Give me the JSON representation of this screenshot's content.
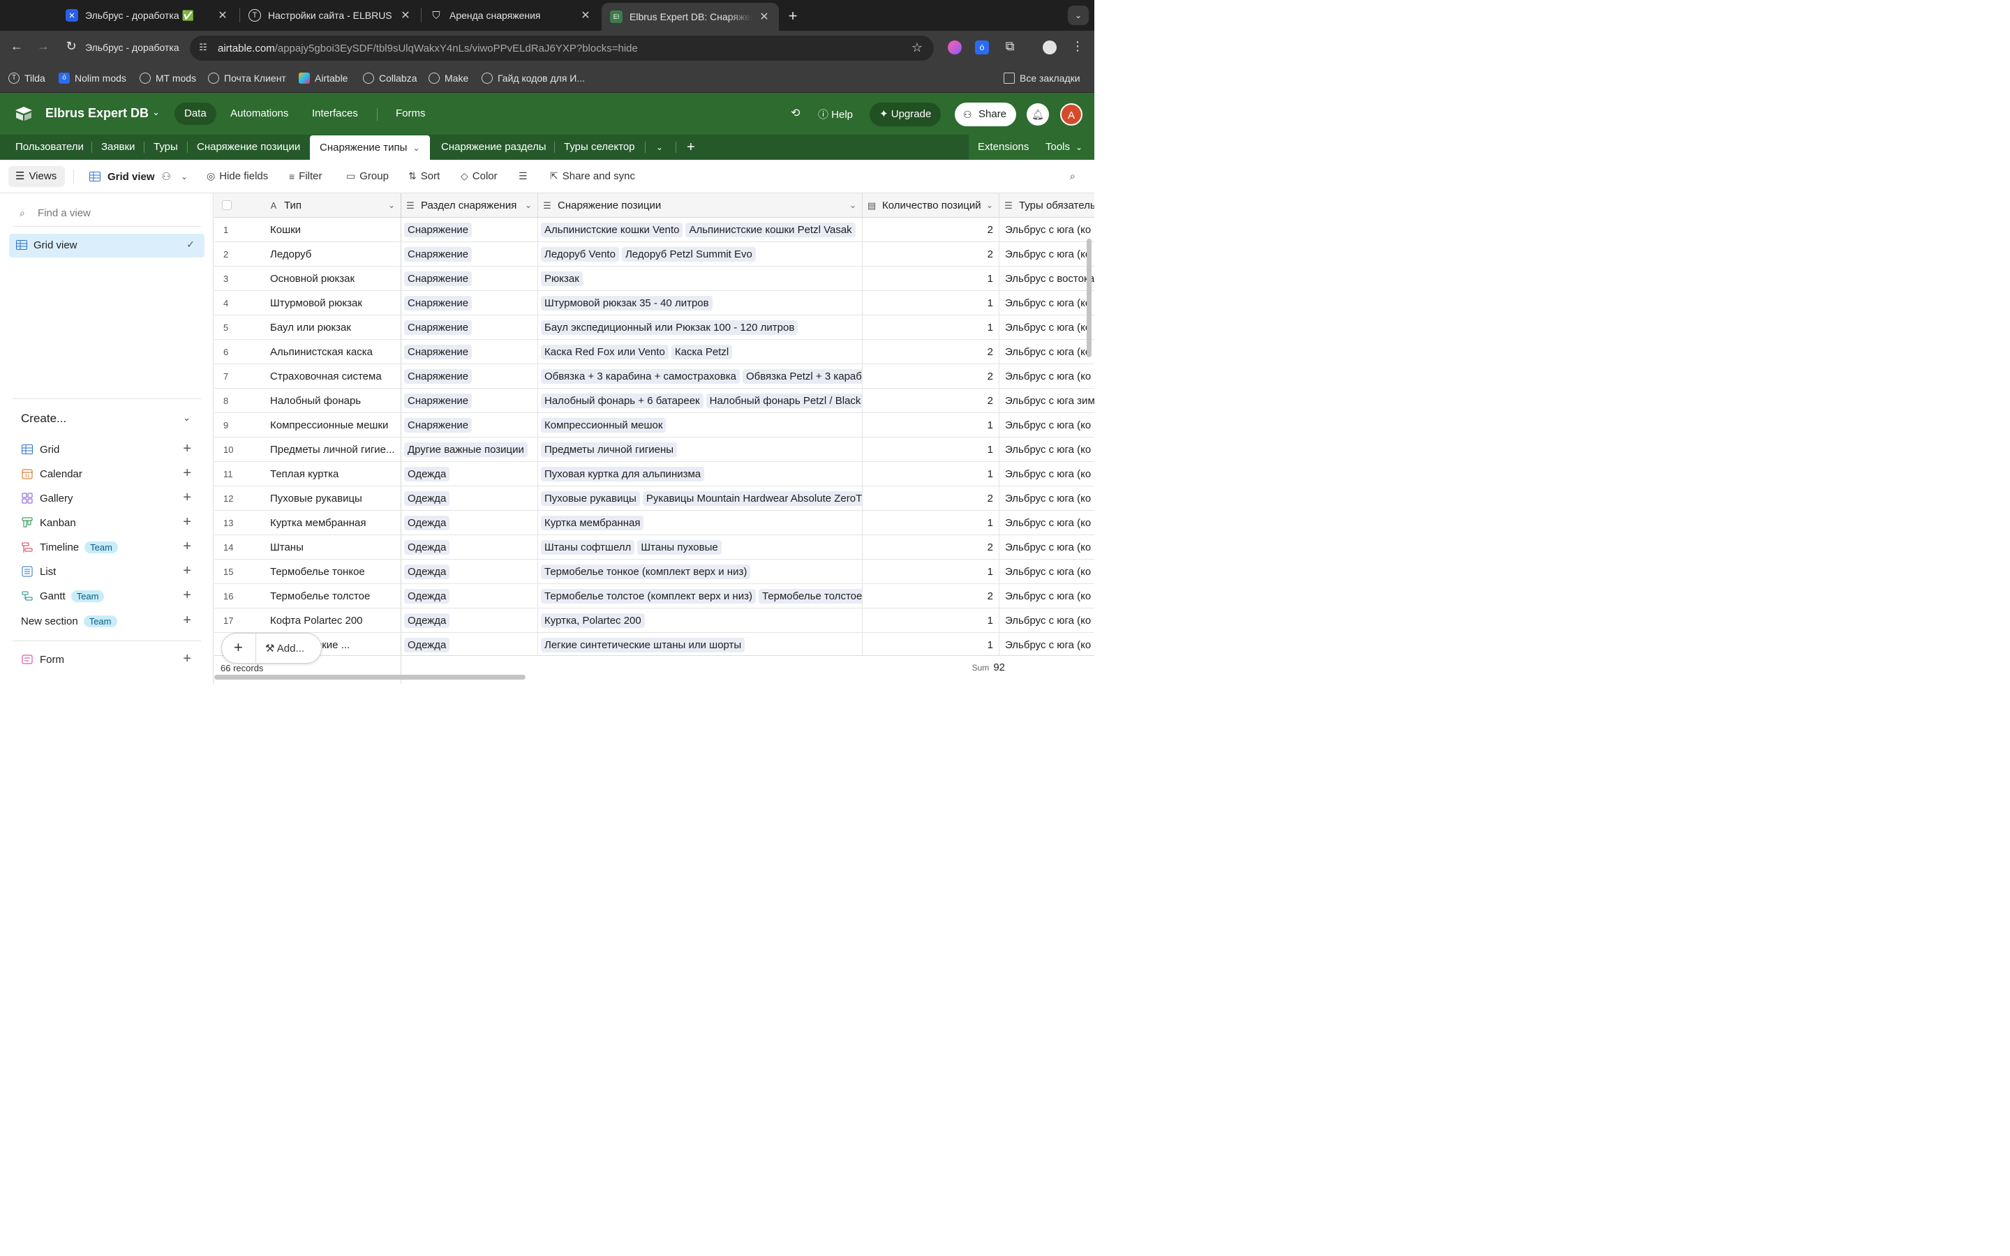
{
  "browser": {
    "tabs": [
      {
        "title": "Эльбрус - доработка ✅"
      },
      {
        "title": "Настройки сайта - ELBRUS E"
      },
      {
        "title": "Аренда снаряжения"
      },
      {
        "title": "Elbrus Expert DB: Снаряжени"
      }
    ],
    "profile_label": "Эльбрус - доработка",
    "url_host": "airtable.com",
    "url_path": "/appajy5gboi3EySDF/tbl9sUlqWakxY4nLs/viwoPPvELdRaJ6YXP?blocks=hide",
    "bookmarks": [
      "Tilda",
      "Nolim mods",
      "MT mods",
      "Почта Клиент",
      "Airtable",
      "Collabza",
      "Make",
      "Гайд кодов для И..."
    ],
    "all_bookmarks": "Все закладки"
  },
  "app": {
    "base_name": "Elbrus Expert DB",
    "nav": [
      "Data",
      "Automations",
      "Interfaces",
      "Forms"
    ],
    "help": "Help",
    "upgrade": "Upgrade",
    "share": "Share",
    "avatar_letter": "A",
    "brand_color": "#2d6b2f"
  },
  "tables": {
    "items": [
      "Пользователи",
      "Заявки",
      "Туры",
      "Снаряжение позиции",
      "Снаряжение типы",
      "Снаряжение разделы",
      "Туры селектор"
    ],
    "active": "Снаряжение типы",
    "extensions": "Extensions",
    "tools": "Tools"
  },
  "viewbar": {
    "views": "Views",
    "view_name": "Grid view",
    "hide_fields": "Hide fields",
    "filter": "Filter",
    "group": "Group",
    "sort": "Sort",
    "color": "Color",
    "share_sync": "Share and sync"
  },
  "sidebar": {
    "find_placeholder": "Find a view",
    "current_view": "Grid view",
    "create_label": "Create...",
    "create_items": [
      {
        "label": "Grid",
        "team": ""
      },
      {
        "label": "Calendar",
        "team": ""
      },
      {
        "label": "Gallery",
        "team": ""
      },
      {
        "label": "Kanban",
        "team": ""
      },
      {
        "label": "Timeline",
        "team": "Team"
      },
      {
        "label": "List",
        "team": ""
      },
      {
        "label": "Gantt",
        "team": "Team"
      },
      {
        "label": "New section",
        "team": "Team"
      }
    ],
    "form_label": "Form"
  },
  "grid": {
    "columns": [
      "Тип",
      "Раздел снаряжения",
      "Снаряжение позиции",
      "Количество позиций",
      "Туры обязатель"
    ],
    "rows": [
      {
        "n": "1",
        "type": "Кошки",
        "section": "Снаряжение",
        "items": [
          "Альпинистские кошки Vento",
          "Альпинистские кошки Petzl Vasak"
        ],
        "count": "2",
        "tour": "Эльбрус с юга (ко"
      },
      {
        "n": "2",
        "type": "Ледоруб",
        "section": "Снаряжение",
        "items": [
          "Ледоруб Vento",
          "Ледоруб Petzl Summit Evo"
        ],
        "count": "2",
        "tour": "Эльбрус с юга (ко"
      },
      {
        "n": "3",
        "type": "Основной рюкзак",
        "section": "Снаряжение",
        "items": [
          "Рюкзак"
        ],
        "count": "1",
        "tour": "Эльбрус с востока"
      },
      {
        "n": "4",
        "type": "Штурмовой рюкзак",
        "section": "Снаряжение",
        "items": [
          "Штурмовой рюкзак 35 - 40 литров"
        ],
        "count": "1",
        "tour": "Эльбрус с юга (ко"
      },
      {
        "n": "5",
        "type": "Баул или рюкзак",
        "section": "Снаряжение",
        "items": [
          "Баул экспедиционный или Рюкзак 100 - 120 литров"
        ],
        "count": "1",
        "tour": "Эльбрус с юга (ко"
      },
      {
        "n": "6",
        "type": "Альпинистская каска",
        "section": "Снаряжение",
        "items": [
          "Каска Red Fox или Vento",
          "Каска Petzl"
        ],
        "count": "2",
        "tour": "Эльбрус с юга (ко"
      },
      {
        "n": "7",
        "type": "Страховочная система",
        "section": "Снаряжение",
        "items": [
          "Обвязка + 3 карабина + самостраховка",
          "Обвязка Petzl + 3 караби"
        ],
        "count": "2",
        "tour": "Эльбрус с юга (ко"
      },
      {
        "n": "8",
        "type": "Налобный фонарь",
        "section": "Снаряжение",
        "items": [
          "Налобный фонарь + 6 батареек",
          "Налобный фонарь Petzl / Black D"
        ],
        "count": "2",
        "tour": "Эльбрус с юга зим"
      },
      {
        "n": "9",
        "type": "Компрессионные мешки",
        "section": "Снаряжение",
        "items": [
          "Компрессионный мешок"
        ],
        "count": "1",
        "tour": "Эльбрус с юга (ко"
      },
      {
        "n": "10",
        "type": "Предметы личной гигие...",
        "section": "Другие важные позиции",
        "items": [
          "Предметы личной гигиены"
        ],
        "count": "1",
        "tour": "Эльбрус с юга (ко"
      },
      {
        "n": "11",
        "type": "Теплая куртка",
        "section": "Одежда",
        "items": [
          "Пуховая куртка для альпинизма"
        ],
        "count": "1",
        "tour": "Эльбрус с юга (ко"
      },
      {
        "n": "12",
        "type": "Пуховые рукавицы",
        "section": "Одежда",
        "items": [
          "Пуховые рукавицы",
          "Рукавицы Mountain Hardwear Absolute ZeroTM"
        ],
        "count": "2",
        "tour": "Эльбрус с юга (ко"
      },
      {
        "n": "13",
        "type": "Куртка мембранная",
        "section": "Одежда",
        "items": [
          "Куртка мембранная"
        ],
        "count": "1",
        "tour": "Эльбрус с юга (ко"
      },
      {
        "n": "14",
        "type": "Штаны",
        "section": "Одежда",
        "items": [
          "Штаны софтшелл",
          "Штаны пуховые"
        ],
        "count": "2",
        "tour": "Эльбрус с юга (ко"
      },
      {
        "n": "15",
        "type": "Термобелье тонкое",
        "section": "Одежда",
        "items": [
          "Термобелье тонкое (комплект верх и низ)"
        ],
        "count": "1",
        "tour": "Эльбрус с юга (ко"
      },
      {
        "n": "16",
        "type": "Термобелье толстое",
        "section": "Одежда",
        "items": [
          "Термобелье толстое (комплект верх и низ)",
          "Термобелье толстое"
        ],
        "count": "2",
        "tour": "Эльбрус с юга (ко"
      },
      {
        "n": "17",
        "type": "Кофта Polartec 200",
        "section": "Одежда",
        "items": [
          "Куртка, Polartec 200"
        ],
        "count": "1",
        "tour": "Эльбрус с юга (ко"
      },
      {
        "n": "18",
        "type": "...нтетические ...",
        "section": "Одежда",
        "items": [
          "Легкие синтетические штаны или шорты"
        ],
        "count": "1",
        "tour": "Эльбрус с юга (ко"
      }
    ],
    "records": "66 records",
    "sum_label": "Sum",
    "sum_value": "92",
    "add_label": "Add..."
  }
}
